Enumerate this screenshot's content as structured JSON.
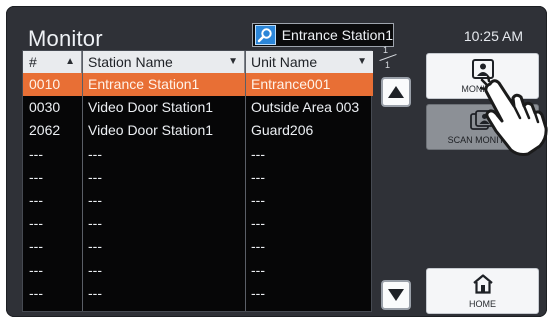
{
  "header": {
    "title": "Monitor",
    "search_text": "Entrance Station1",
    "time": "10:25 AM"
  },
  "table": {
    "columns": [
      {
        "label": "#",
        "sort": "asc"
      },
      {
        "label": "Station Name",
        "sort": "desc"
      },
      {
        "label": "Unit Name",
        "sort": "desc"
      }
    ],
    "rows": [
      [
        "0010",
        "Entrance Station1",
        "Entrance001"
      ],
      [
        "0030",
        "Video Door Station1",
        "Outside Area 003"
      ],
      [
        "2062",
        "Video Door Station1",
        "Guard206"
      ],
      [
        "---",
        "---",
        "---"
      ],
      [
        "---",
        "---",
        "---"
      ],
      [
        "---",
        "---",
        "---"
      ],
      [
        "---",
        "---",
        "---"
      ],
      [
        "---",
        "---",
        "---"
      ],
      [
        "---",
        "---",
        "---"
      ],
      [
        "---",
        "---",
        "---"
      ]
    ],
    "selected_row": 0
  },
  "pager": {
    "current": "1",
    "total": "1"
  },
  "buttons": {
    "monitor": "MONITOR",
    "scan_monitor": "SCAN MONITOR",
    "home": "HOME"
  },
  "colors": {
    "accent_selected": "#e86f35",
    "panel": "#2f3137",
    "search_icon": "#2c86d8"
  }
}
